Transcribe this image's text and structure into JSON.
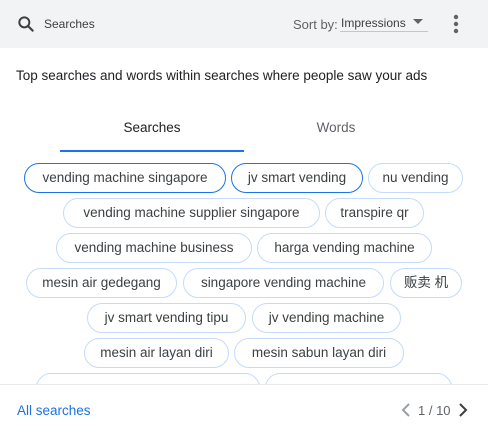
{
  "header": {
    "search_icon": "search-icon",
    "search_label": "Searches",
    "sort_by_label": "Sort by:",
    "sort_by_value": "Impressions",
    "more_icon": "more-vert-icon"
  },
  "description": "Top searches and words within searches where people saw your ads",
  "tabs": [
    {
      "label": "Searches",
      "selected": true
    },
    {
      "label": "Words",
      "selected": false
    }
  ],
  "chips": [
    {
      "label": "vending machine singapore",
      "selected": true
    },
    {
      "label": "jv smart vending",
      "selected": true
    },
    {
      "label": "nu vending",
      "selected": false
    },
    {
      "label": "vending machine supplier singapore",
      "selected": false
    },
    {
      "label": "transpire qr",
      "selected": false
    },
    {
      "label": "vending machine business",
      "selected": false
    },
    {
      "label": "harga vending machine",
      "selected": false
    },
    {
      "label": "mesin air gedegang",
      "selected": false
    },
    {
      "label": "singapore vending machine",
      "selected": false
    },
    {
      "label": "贩卖 机",
      "selected": false
    },
    {
      "label": "jv smart vending tipu",
      "selected": false
    },
    {
      "label": "jv vending machine",
      "selected": false
    },
    {
      "label": "mesin air layan diri",
      "selected": false
    },
    {
      "label": "mesin sabun layan diri",
      "selected": false
    },
    {
      "label": "",
      "selected": false
    },
    {
      "label": "",
      "selected": false
    }
  ],
  "footer": {
    "all_searches_label": "All searches",
    "prev_icon": "chevron-left-icon",
    "page_indicator": "1 / 10",
    "next_icon": "chevron-right-icon"
  },
  "colors": {
    "accent": "#1a73e8",
    "chip_border": "#c6dafc",
    "header_bg": "#f1f3f4"
  }
}
